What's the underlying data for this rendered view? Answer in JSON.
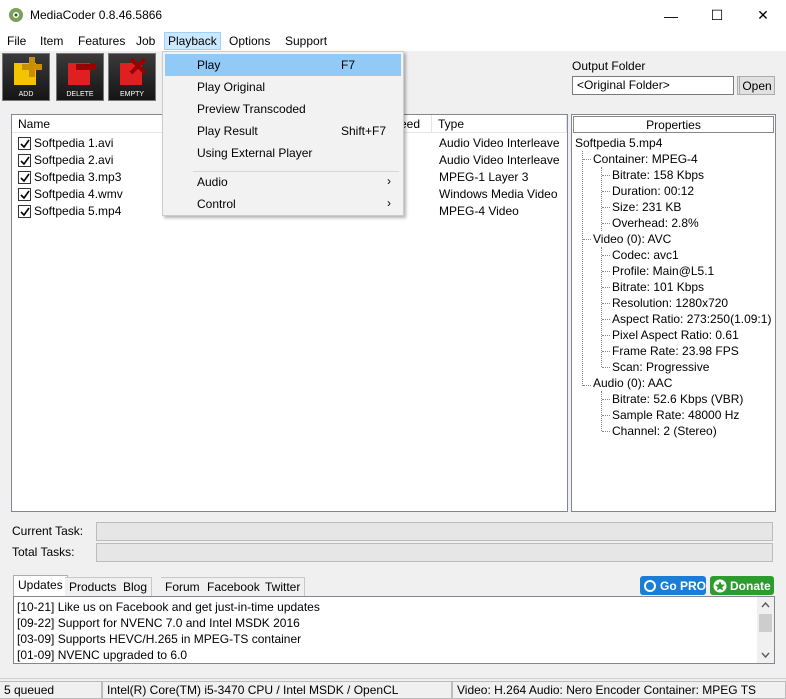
{
  "window": {
    "title": "MediaCoder 0.8.46.5866",
    "minimize": "—",
    "maximize": "☐",
    "close": "✕"
  },
  "menu": [
    "File",
    "Item",
    "Features",
    "Job",
    "Playback",
    "Options",
    "Support"
  ],
  "toolbar": [
    {
      "label": "ADD",
      "color": "#f5c400",
      "icon": "plus-icon"
    },
    {
      "label": "DELETE",
      "color": "#e02020",
      "icon": "minus-icon"
    },
    {
      "label": "EMPTY",
      "color": "#e02020",
      "icon": "x-icon"
    }
  ],
  "output_folder": {
    "label": "Output Folder",
    "value": "<Original Folder>",
    "browse": "...",
    "open": "Open"
  },
  "filelist": {
    "columns": [
      "Name",
      "eed",
      "Type"
    ],
    "rows": [
      {
        "name": "Softpedia 1.avi",
        "type": "Audio Video Interleave",
        "checked": true
      },
      {
        "name": "Softpedia 2.avi",
        "type": "Audio Video Interleave",
        "checked": true
      },
      {
        "name": "Softpedia 3.mp3",
        "type": "MPEG-1 Layer 3",
        "checked": true
      },
      {
        "name": "Softpedia 4.wmv",
        "type": "Windows Media Video",
        "checked": true
      },
      {
        "name": "Softpedia 5.mp4",
        "type": "MPEG-4 Video",
        "checked": true
      }
    ]
  },
  "properties": {
    "header": "Properties",
    "root": "Softpedia 5.mp4",
    "container": "Container: MPEG-4",
    "container_items": [
      "Bitrate: 158 Kbps",
      "Duration: 00:12",
      "Size: 231 KB",
      "Overhead: 2.8%"
    ],
    "video": "Video (0): AVC",
    "video_items": [
      "Codec: avc1",
      "Profile: Main@L5.1",
      "Bitrate: 101 Kbps",
      "Resolution: 1280x720",
      "Aspect Ratio: 273:250(1.09:1)",
      "Pixel Aspect Ratio: 0.61",
      "Frame Rate: 23.98 FPS",
      "Scan: Progressive"
    ],
    "audio": "Audio (0): AAC",
    "audio_items": [
      "Bitrate: 52.6 Kbps (VBR)",
      "Sample Rate: 48000 Hz",
      "Channel: 2 (Stereo)"
    ]
  },
  "tasks": {
    "current": "Current Task:",
    "total": "Total Tasks:"
  },
  "tabs": [
    "Updates",
    "Products",
    "Blog",
    "Forum",
    "Facebook",
    "Twitter"
  ],
  "badges": {
    "gopro": "Go PRO",
    "donate": "Donate"
  },
  "log": [
    "[10-21] Like us on Facebook and get just-in-time updates",
    "[09-22] Support for NVENC 7.0 and Intel MSDK 2016",
    "[03-09] Supports HEVC/H.265 in MPEG-TS container",
    "[01-09] NVENC upgraded to 6.0"
  ],
  "status": {
    "queued": "5 queued",
    "cpu": "Intel(R) Core(TM) i5-3470 CPU  / Intel MSDK / OpenCL",
    "codec": "Video: H.264  Audio: Nero Encoder  Container: MPEG TS"
  },
  "playback_menu": {
    "items": [
      {
        "label": "Play",
        "shortcut": "F7"
      },
      {
        "label": "Play Original",
        "shortcut": ""
      },
      {
        "label": "Preview Transcoded",
        "shortcut": ""
      },
      {
        "label": "Play Result",
        "shortcut": "Shift+F7"
      },
      {
        "label": "Using External Player",
        "shortcut": ""
      },
      {
        "label": "Audio",
        "shortcut": ""
      },
      {
        "label": "Control",
        "shortcut": ""
      }
    ],
    "submenu_arrow": "›"
  }
}
